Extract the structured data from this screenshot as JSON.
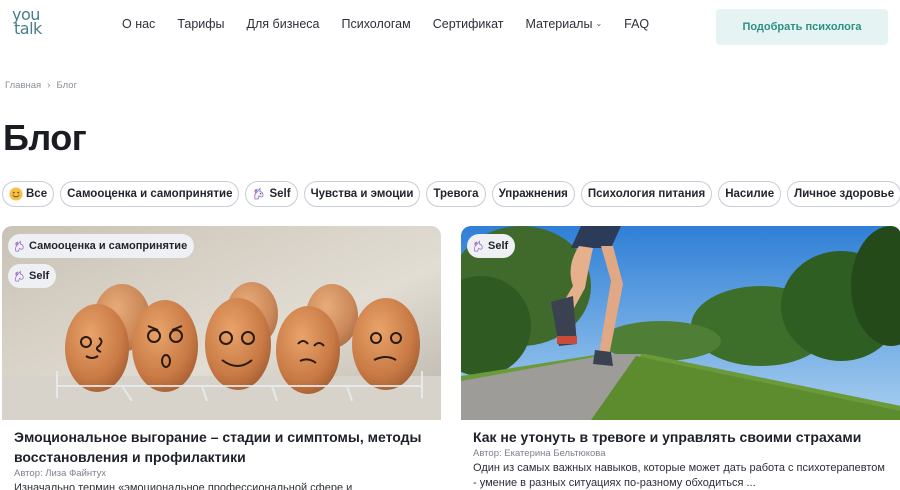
{
  "header": {
    "logo_line1": "you",
    "logo_line2": "talk",
    "nav": [
      "О нас",
      "Тарифы",
      "Для бизнеса",
      "Психологам",
      "Сертификат",
      "Материалы",
      "FAQ"
    ],
    "cta_label": "Подобрать психолога"
  },
  "breadcrumb": {
    "home": "Главная",
    "current": "Блог"
  },
  "page_title": "Блог",
  "filters": [
    {
      "label": "Все",
      "icon": "smile-emoji-icon"
    },
    {
      "label": "Самооценка и самопринятие",
      "icon": ""
    },
    {
      "label": "Self",
      "icon": "unicorn-icon"
    },
    {
      "label": "Чувства и эмоции",
      "icon": ""
    },
    {
      "label": "Тревога",
      "icon": ""
    },
    {
      "label": "Упражнения",
      "icon": ""
    },
    {
      "label": "Психология питания",
      "icon": ""
    },
    {
      "label": "Насилие",
      "icon": ""
    },
    {
      "label": "Личное здоровье",
      "icon": ""
    }
  ],
  "cards": [
    {
      "tags": [
        "Самооценка и самопринятие",
        "Self"
      ],
      "title": "Эмоциональное выгорание – стадии и симптомы, методы восстановления и профилактики",
      "author": "Автор: Лиза Файнтух",
      "excerpt": "Изначально термин «эмоциональное профессиональной сфере и"
    },
    {
      "tags": [
        "Self"
      ],
      "title": "Как не утонуть в тревоге и управлять своими страхами",
      "author": "Автор: Екатерина Бельтюкова",
      "excerpt": "Один из самых важных навыков, которые может дать работа с психотерапевтом - умение в разных ситуациях по-разному обходиться ..."
    }
  ],
  "colors": {
    "accent": "#2d8f84",
    "cta_bg": "#e5f4f3",
    "logo": "#4a7c8c"
  }
}
